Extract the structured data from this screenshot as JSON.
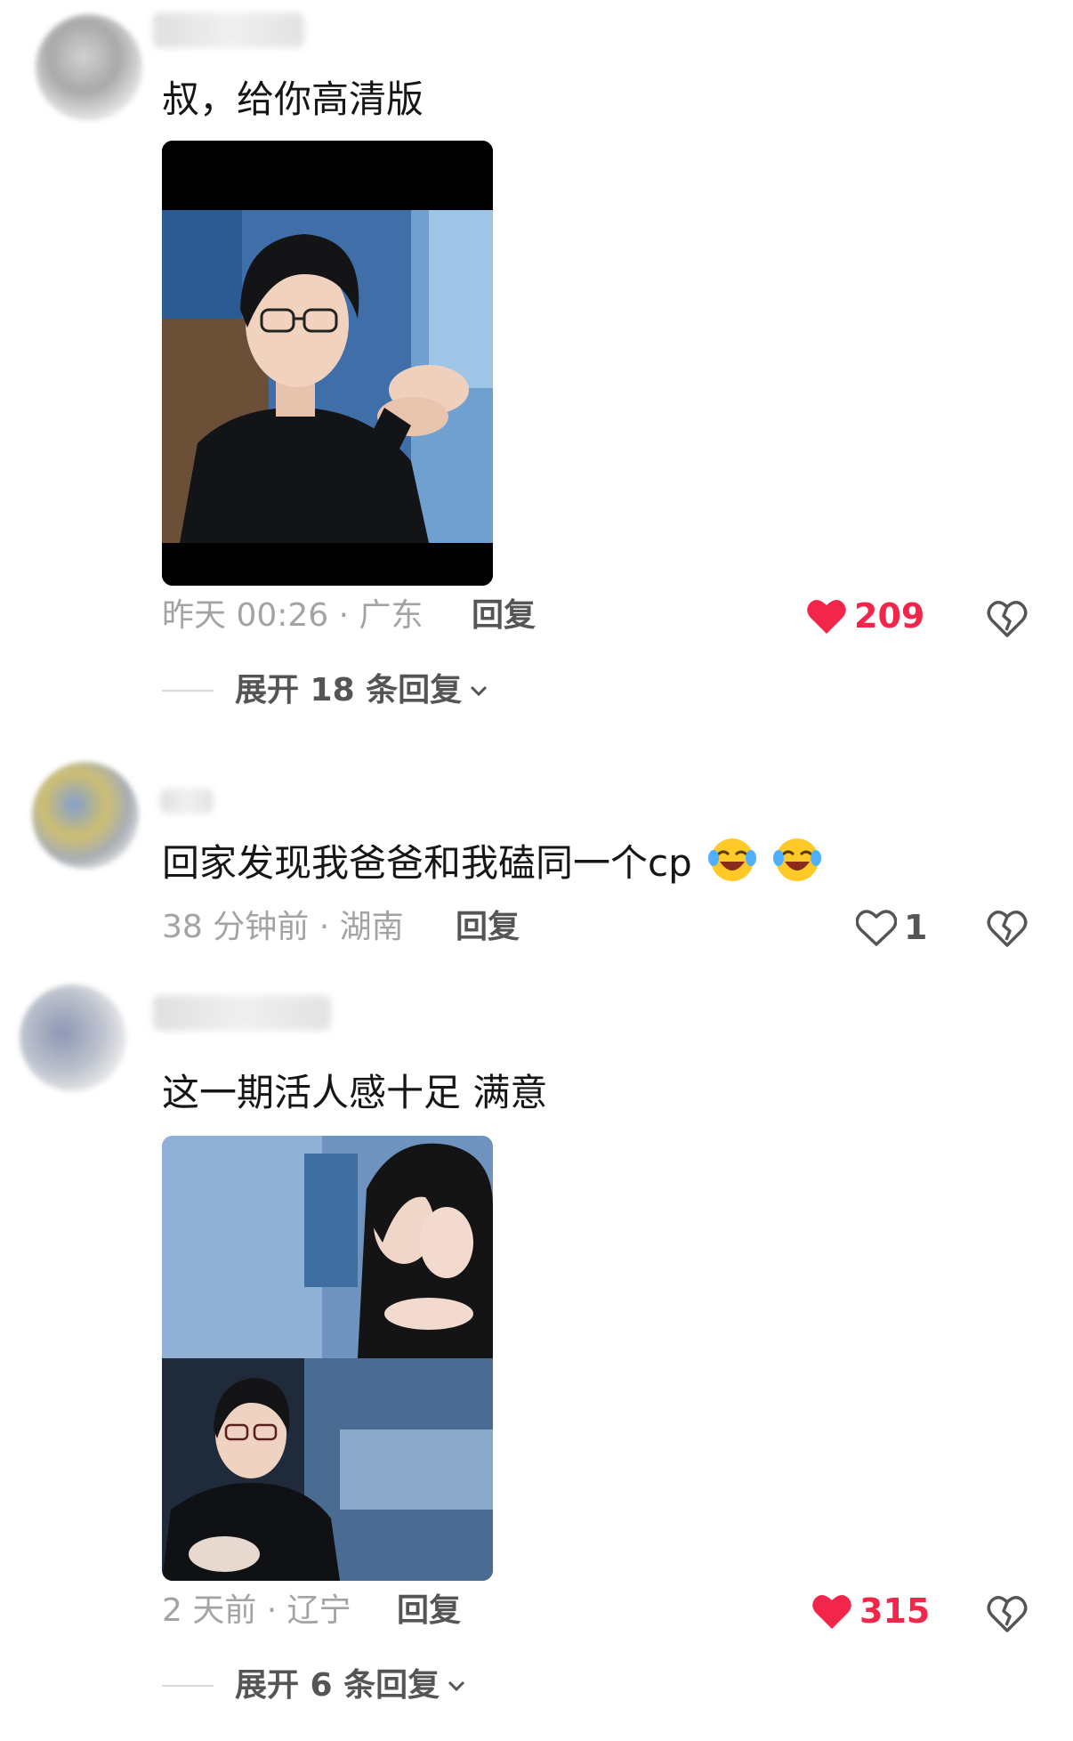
{
  "colors": {
    "like_red": "#f2254a",
    "meta_gray": "#a3a3a3",
    "action_gray": "#555555"
  },
  "comments": [
    {
      "text": "叔，给你高清版",
      "time_location": "昨天 00:26 · 广东",
      "reply_label": "回复",
      "likes": "209",
      "liked": true,
      "expand_label": "展开 18 条回复",
      "image": "photo-man-glasses"
    },
    {
      "text": "回家发现我爸爸和我磕同一个cp",
      "emojis": [
        "crying-laughing-emoji",
        "crying-laughing-emoji"
      ],
      "time_location": "38 分钟前 · 湖南",
      "reply_label": "回复",
      "likes": "1",
      "liked": false
    },
    {
      "text": "这一期活人感十足 满意",
      "time_location": "2 天前 · 辽宁",
      "reply_label": "回复",
      "likes": "315",
      "liked": true,
      "expand_label": "展开 6 条回复",
      "image": "photo-collage"
    }
  ],
  "icons": {
    "like": "heart-icon",
    "dislike": "broken-heart-icon",
    "expand": "chevron-down-icon"
  }
}
